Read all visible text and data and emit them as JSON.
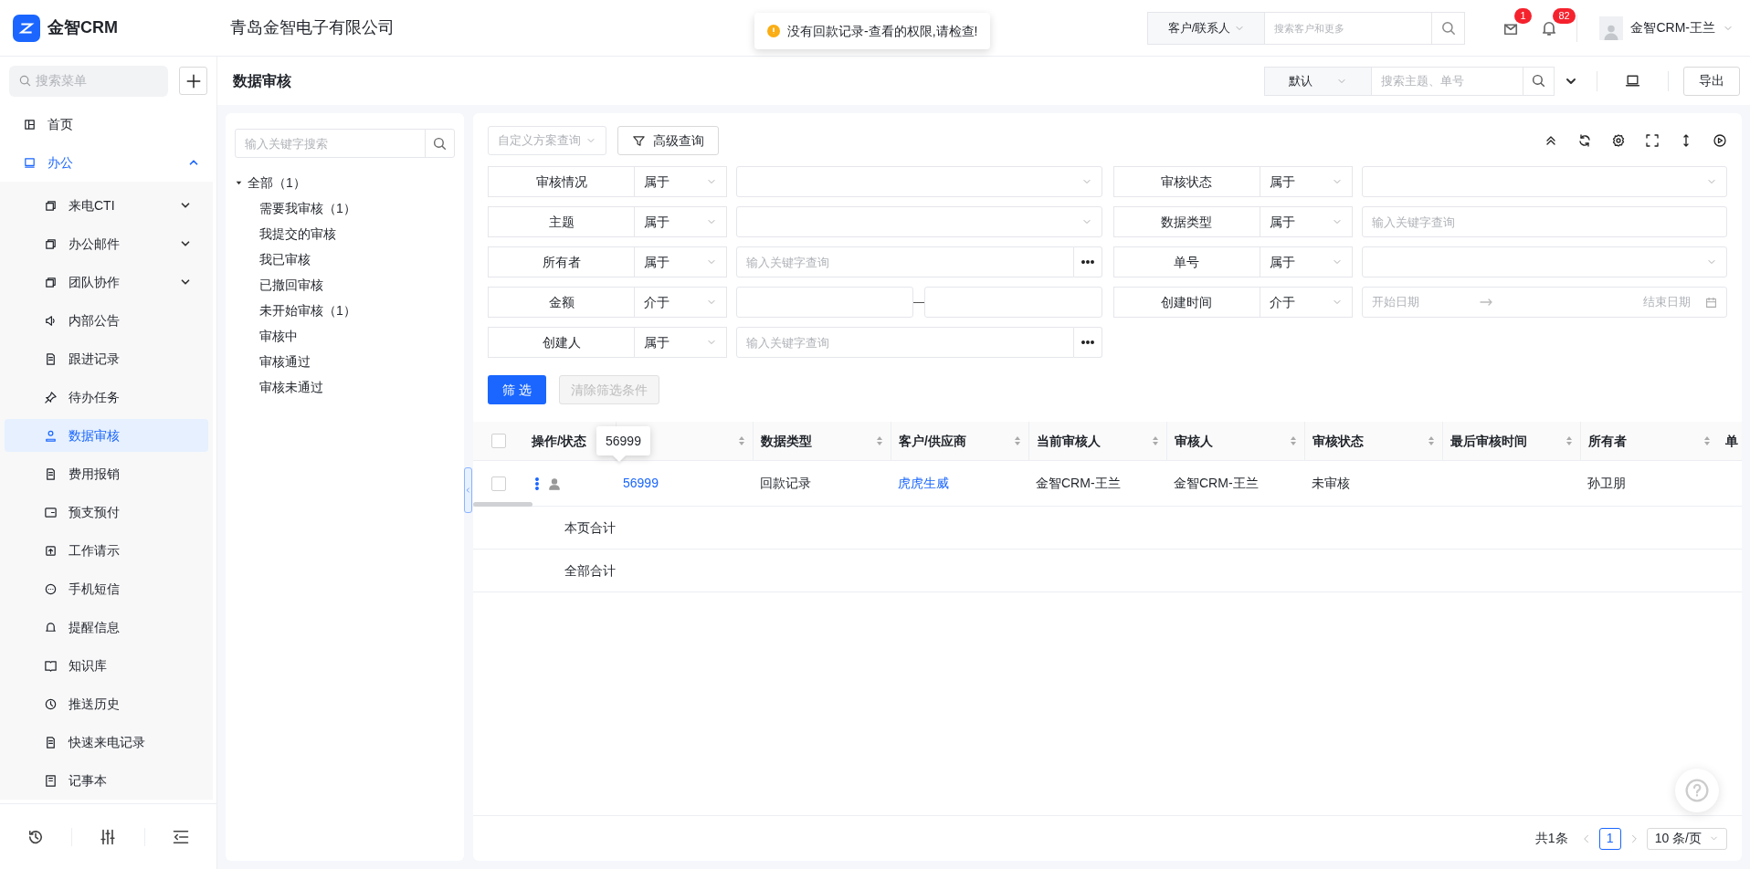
{
  "app": {
    "name": "金智CRM",
    "company": "青岛金智电子有限公司"
  },
  "toast": {
    "message": "没有回款记录-查看的权限,请检查!"
  },
  "global_search": {
    "scope": "客户/联系人",
    "placeholder": "搜索客户和更多"
  },
  "notifications": [
    {
      "count": "1"
    },
    {
      "count": "82"
    }
  ],
  "user": {
    "name": "金智CRM-王兰"
  },
  "sidebar": {
    "search_placeholder": "搜索菜单",
    "items": [
      {
        "label": "首页",
        "kind": "page",
        "selected": false
      },
      {
        "label": "办公",
        "kind": "group",
        "selected": false,
        "expanded": true,
        "children": [
          {
            "label": "来电CTI",
            "kind": "group",
            "selected": false,
            "expanded": false
          },
          {
            "label": "办公邮件",
            "kind": "group",
            "selected": false,
            "expanded": false
          },
          {
            "label": "团队协作",
            "kind": "group",
            "selected": false,
            "expanded": false
          },
          {
            "label": "内部公告",
            "kind": "page",
            "selected": false
          },
          {
            "label": "跟进记录",
            "kind": "page",
            "selected": false
          },
          {
            "label": "待办任务",
            "kind": "page",
            "selected": false
          },
          {
            "label": "数据审核",
            "kind": "page",
            "selected": true
          },
          {
            "label": "费用报销",
            "kind": "page",
            "selected": false
          },
          {
            "label": "预支预付",
            "kind": "page",
            "selected": false
          },
          {
            "label": "工作请示",
            "kind": "page",
            "selected": false
          },
          {
            "label": "手机短信",
            "kind": "page",
            "selected": false
          },
          {
            "label": "提醒信息",
            "kind": "page",
            "selected": false
          },
          {
            "label": "知识库",
            "kind": "page",
            "selected": false
          },
          {
            "label": "推送历史",
            "kind": "page",
            "selected": false
          },
          {
            "label": "快速来电记录",
            "kind": "page",
            "selected": false
          },
          {
            "label": "记事本",
            "kind": "page",
            "selected": false
          }
        ]
      }
    ]
  },
  "page": {
    "title": "数据审核",
    "view": "默认",
    "search_placeholder": "搜索主题、单号",
    "export": "导出"
  },
  "tree": {
    "search_placeholder": "输入关键字搜索",
    "items": [
      {
        "label": "全部（1）",
        "expanded": true,
        "children": [
          {
            "label": "需要我审核（1）"
          },
          {
            "label": "我提交的审核"
          },
          {
            "label": "我已审核"
          },
          {
            "label": "已撤回审核"
          },
          {
            "label": "未开始审核（1）"
          },
          {
            "label": "审核中"
          },
          {
            "label": "审核通过"
          },
          {
            "label": "审核未通过"
          }
        ]
      }
    ]
  },
  "query": {
    "scheme_placeholder": "自定义方案查询",
    "advanced": "高级查询"
  },
  "filters": [
    {
      "label": "审核情况",
      "operator": "属于",
      "kind": "select"
    },
    {
      "label": "审核状态",
      "operator": "属于",
      "kind": "select"
    },
    {
      "label": "主题",
      "operator": "属于",
      "kind": "select"
    },
    {
      "label": "数据类型",
      "operator": "属于",
      "kind": "text",
      "placeholder": "输入关键字查询"
    },
    {
      "label": "所有者",
      "operator": "属于",
      "kind": "lookup",
      "placeholder": "输入关键字查询"
    },
    {
      "label": "单号",
      "operator": "属于",
      "kind": "select"
    },
    {
      "label": "金额",
      "operator": "介于",
      "kind": "range"
    },
    {
      "label": "创建时间",
      "operator": "介于",
      "kind": "daterange",
      "start_placeholder": "开始日期",
      "end_placeholder": "结束日期"
    },
    {
      "label": "创建人",
      "operator": "属于",
      "kind": "lookup",
      "placeholder": "输入关键字查询"
    }
  ],
  "filter_buttons": {
    "apply": "筛 选",
    "clear": "清除筛选条件",
    "clear_disabled": true
  },
  "table": {
    "select_all": {
      "checked": false
    },
    "columns": [
      {
        "label": "操作/状态",
        "sortable": false
      },
      {
        "sortable": true
      },
      {
        "label": "数据类型",
        "sortable": true
      },
      {
        "label": "客户/供应商",
        "sortable": true
      },
      {
        "label": "当前审核人",
        "sortable": true
      },
      {
        "label": "审核人",
        "sortable": true
      },
      {
        "label": "审核状态",
        "sortable": true
      },
      {
        "label": "最后审核时间",
        "sortable": true
      },
      {
        "label": "所有者",
        "sortable": true
      },
      {
        "label": "单",
        "sortable": false
      }
    ],
    "rows": [
      {
        "checked": false,
        "cells": [
          {
            "kind": "actions"
          },
          {
            "kind": "link",
            "text": "56999"
          },
          {
            "kind": "text",
            "text": "回款记录"
          },
          {
            "kind": "link",
            "text": "虎虎生威"
          },
          {
            "kind": "text",
            "text": "金智CRM-王兰"
          },
          {
            "kind": "text",
            "text": "金智CRM-王兰"
          },
          {
            "kind": "text",
            "text": "未审核"
          },
          {
            "kind": "empty"
          },
          {
            "kind": "text",
            "text": "孙卫朋"
          },
          {
            "kind": "empty"
          }
        ]
      }
    ],
    "tooltip": "56999",
    "summary_rows": [
      "本页合计",
      "全部合计"
    ]
  },
  "pagination": {
    "total": "共1条",
    "pages": [
      {
        "label": "1",
        "selected": true
      }
    ],
    "page_size": "10 条/页"
  }
}
